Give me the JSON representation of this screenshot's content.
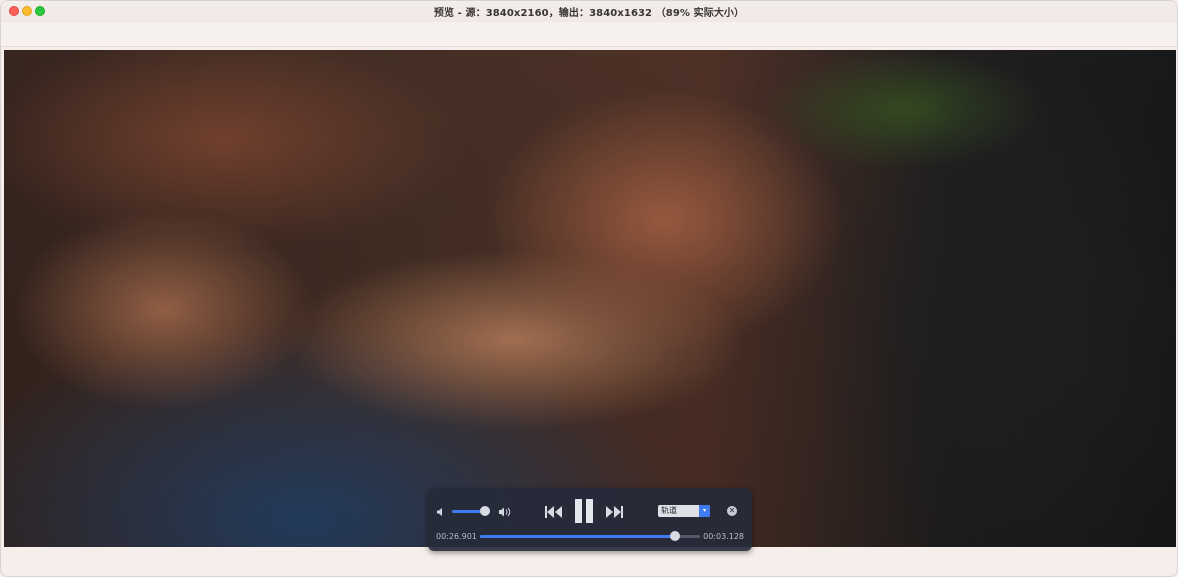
{
  "window": {
    "title": "预览 - 源：3840x2160，输出：3840x1632 （89% 实际大小）"
  },
  "player": {
    "volume": 0.75,
    "track_label": "轨道",
    "track_arrow": "▾",
    "time_elapsed": "00:26.901",
    "time_remaining": "00:03.128",
    "progress": 0.885,
    "icons": {
      "volume_low": "speaker-low-icon",
      "volume_high": "speaker-high-icon",
      "prev": "skip-back-icon",
      "pause": "pause-icon",
      "next": "skip-forward-icon",
      "close": "close-icon"
    },
    "close_glyph": "✕"
  },
  "colors": {
    "accent": "#3f7cf2",
    "hud_bg": "#262a3a"
  }
}
